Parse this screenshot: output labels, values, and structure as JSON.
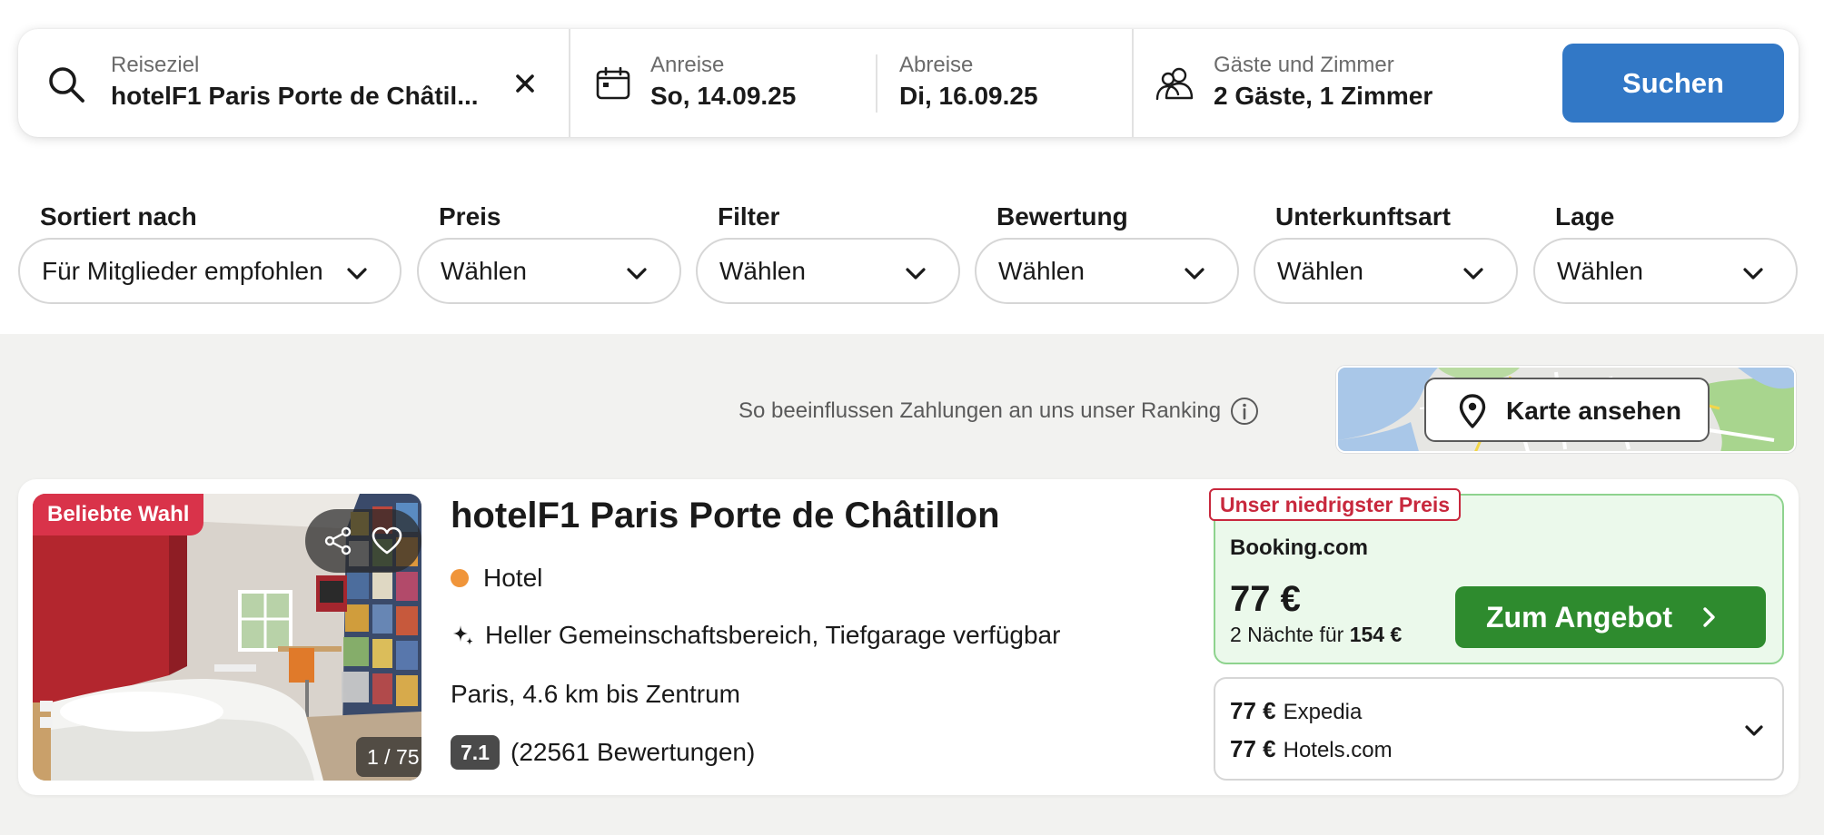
{
  "search": {
    "destination_label": "Reiseziel",
    "destination_value": "hotelF1 Paris Porte de Châtil...",
    "checkin_label": "Anreise",
    "checkin_value": "So, 14.09.25",
    "checkout_label": "Abreise",
    "checkout_value": "Di, 16.09.25",
    "guests_label": "Gäste und Zimmer",
    "guests_value": "2 Gäste, 1 Zimmer",
    "search_button": "Suchen"
  },
  "filters": [
    {
      "label": "Sortiert nach",
      "value": "Für Mitglieder empfohlen"
    },
    {
      "label": "Preis",
      "value": "Wählen"
    },
    {
      "label": "Filter",
      "value": "Wählen"
    },
    {
      "label": "Bewertung",
      "value": "Wählen"
    },
    {
      "label": "Unterkunftsart",
      "value": "Wählen"
    },
    {
      "label": "Lage",
      "value": "Wählen"
    }
  ],
  "results": {
    "ranking_note": "So beeinflussen Zahlungen an uns unser Ranking",
    "map_button": "Karte ansehen"
  },
  "hotel": {
    "badge": "Beliebte Wahl",
    "photo_counter": "1 / 75",
    "name": "hotelF1 Paris Porte de Châtillon",
    "type": "Hotel",
    "feature": "Heller Gemeinschaftsbereich, Tiefgarage verfügbar",
    "location": "Paris, 4.6 km bis Zentrum",
    "rating": "7.1",
    "reviews": "(22561 Bewertungen)"
  },
  "deal": {
    "badge": "Unser niedrigster Preis",
    "provider": "Booking.com",
    "price": "77 €",
    "total_prefix": "2 Nächte für",
    "total_value": "154 €",
    "button": "Zum Angebot"
  },
  "other_deals": [
    {
      "price": "77 €",
      "provider": "Expedia"
    },
    {
      "price": "77 €",
      "provider": "Hotels.com"
    }
  ],
  "colors": {
    "accent_blue": "#3278c6",
    "deal_green": "#2e8b2e",
    "badge_red": "#d9334a",
    "hotel_type_dot": "#f0953a"
  },
  "icons": [
    "search-icon",
    "close-icon",
    "calendar-icon",
    "guests-icon",
    "chevron-down-icon",
    "info-icon",
    "map-pin-icon",
    "share-icon",
    "heart-icon",
    "sparkle-icon",
    "chevron-right-icon"
  ]
}
